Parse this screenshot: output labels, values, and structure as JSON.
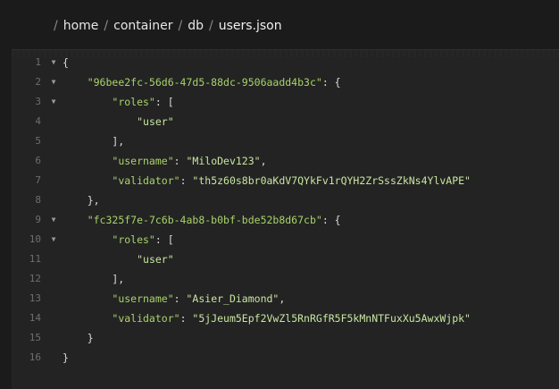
{
  "breadcrumb": {
    "separator": "/",
    "segments": [
      "home",
      "container",
      "db",
      "users.json"
    ]
  },
  "editor": {
    "language": "json",
    "lines": [
      {
        "number": "1",
        "foldable": true,
        "tokens": [
          {
            "t": "punc",
            "v": "{"
          }
        ]
      },
      {
        "number": "2",
        "foldable": true,
        "tokens": [
          {
            "t": "punc",
            "v": "    "
          },
          {
            "t": "key",
            "v": "\"96bee2fc-56d6-47d5-88dc-9506aadd4b3c\""
          },
          {
            "t": "punc",
            "v": ": {"
          }
        ]
      },
      {
        "number": "3",
        "foldable": true,
        "tokens": [
          {
            "t": "punc",
            "v": "        "
          },
          {
            "t": "key",
            "v": "\"roles\""
          },
          {
            "t": "punc",
            "v": ": ["
          }
        ]
      },
      {
        "number": "4",
        "foldable": false,
        "tokens": [
          {
            "t": "punc",
            "v": "            "
          },
          {
            "t": "str",
            "v": "\"user\""
          }
        ]
      },
      {
        "number": "5",
        "foldable": false,
        "tokens": [
          {
            "t": "punc",
            "v": "        ],"
          }
        ]
      },
      {
        "number": "6",
        "foldable": false,
        "tokens": [
          {
            "t": "punc",
            "v": "        "
          },
          {
            "t": "key",
            "v": "\"username\""
          },
          {
            "t": "punc",
            "v": ": "
          },
          {
            "t": "str",
            "v": "\"MiloDev123\""
          },
          {
            "t": "punc",
            "v": ","
          }
        ]
      },
      {
        "number": "7",
        "foldable": false,
        "tokens": [
          {
            "t": "punc",
            "v": "        "
          },
          {
            "t": "key",
            "v": "\"validator\""
          },
          {
            "t": "punc",
            "v": ": "
          },
          {
            "t": "str",
            "v": "\"th5z60s8br0aKdV7QYkFv1rQYH2ZrSssZkNs4YlvAPE\""
          }
        ]
      },
      {
        "number": "8",
        "foldable": false,
        "tokens": [
          {
            "t": "punc",
            "v": "    },"
          }
        ]
      },
      {
        "number": "9",
        "foldable": true,
        "tokens": [
          {
            "t": "punc",
            "v": "    "
          },
          {
            "t": "key",
            "v": "\"fc325f7e-7c6b-4ab8-b0bf-bde52b8d67cb\""
          },
          {
            "t": "punc",
            "v": ": {"
          }
        ]
      },
      {
        "number": "10",
        "foldable": true,
        "tokens": [
          {
            "t": "punc",
            "v": "        "
          },
          {
            "t": "key",
            "v": "\"roles\""
          },
          {
            "t": "punc",
            "v": ": ["
          }
        ]
      },
      {
        "number": "11",
        "foldable": false,
        "tokens": [
          {
            "t": "punc",
            "v": "            "
          },
          {
            "t": "str",
            "v": "\"user\""
          }
        ]
      },
      {
        "number": "12",
        "foldable": false,
        "tokens": [
          {
            "t": "punc",
            "v": "        ],"
          }
        ]
      },
      {
        "number": "13",
        "foldable": false,
        "tokens": [
          {
            "t": "punc",
            "v": "        "
          },
          {
            "t": "key",
            "v": "\"username\""
          },
          {
            "t": "punc",
            "v": ": "
          },
          {
            "t": "str",
            "v": "\"Asier_Diamond\""
          },
          {
            "t": "punc",
            "v": ","
          }
        ]
      },
      {
        "number": "14",
        "foldable": false,
        "tokens": [
          {
            "t": "punc",
            "v": "        "
          },
          {
            "t": "key",
            "v": "\"validator\""
          },
          {
            "t": "punc",
            "v": ": "
          },
          {
            "t": "str",
            "v": "\"5jJeum5Epf2VwZl5RnRGfR5F5kMnNTFuxXu5AwxWjpk\""
          }
        ]
      },
      {
        "number": "15",
        "foldable": false,
        "tokens": [
          {
            "t": "punc",
            "v": "    }"
          }
        ]
      },
      {
        "number": "16",
        "foldable": false,
        "tokens": [
          {
            "t": "punc",
            "v": "}"
          }
        ]
      }
    ]
  },
  "icons": {
    "fold": "chevron-down-icon",
    "fold_glyph": "▼"
  },
  "colors": {
    "background": "#1b1b1b",
    "editor_background": "#232323",
    "key": "#a8d36b",
    "string": "#c8e6a0",
    "punctuation": "#dcdcdc",
    "line_number": "#6e6e6e"
  }
}
